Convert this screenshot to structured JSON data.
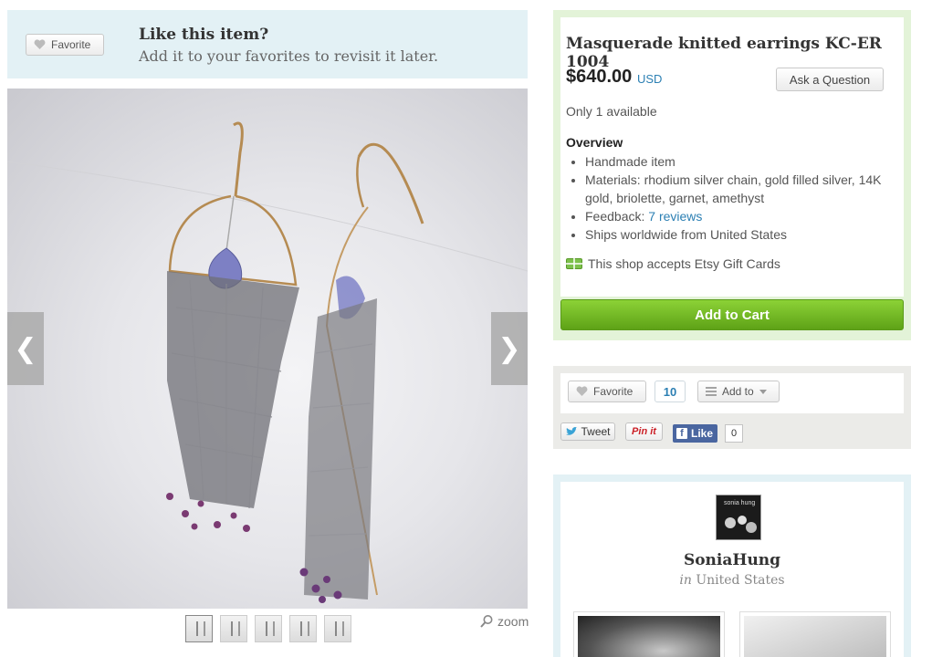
{
  "favorite_banner": {
    "button_label": "Favorite",
    "title": "Like this item?",
    "subtitle": "Add it to your favorites to revisit it later."
  },
  "gallery": {
    "prev_icon": "chevron-left-icon",
    "next_icon": "chevron-right-icon",
    "thumbnail_count": 5,
    "zoom_label": "zoom"
  },
  "listing": {
    "title": "Masquerade knitted earrings KC-ER 1004",
    "price": "$640.00",
    "currency": "USD",
    "ask_button": "Ask a Question",
    "availability": "Only 1 available",
    "overview_heading": "Overview",
    "overview": {
      "item1": "Handmade item",
      "item2": "Materials: rhodium silver chain, gold filled silver, 14K gold, briolette, garnet, amethyst",
      "feedback_label": "Feedback:",
      "feedback_link": "7 reviews",
      "item4": "Ships worldwide from United States"
    },
    "gift_cards": "This shop accepts Etsy Gift Cards",
    "add_to_cart": "Add to Cart",
    "colors": {
      "cart_green": "#6bb51f",
      "link_blue": "#2b7fb3"
    }
  },
  "social": {
    "favorite_label": "Favorite",
    "favorite_count": "10",
    "add_to_label": "Add to",
    "tweet_label": "Tweet",
    "pin_label": "Pin it",
    "like_label": "Like",
    "like_count": "0"
  },
  "shop": {
    "avatar_text": "sonia hung",
    "name": "SoniaHung",
    "location_prefix": "in",
    "location": "United States"
  }
}
